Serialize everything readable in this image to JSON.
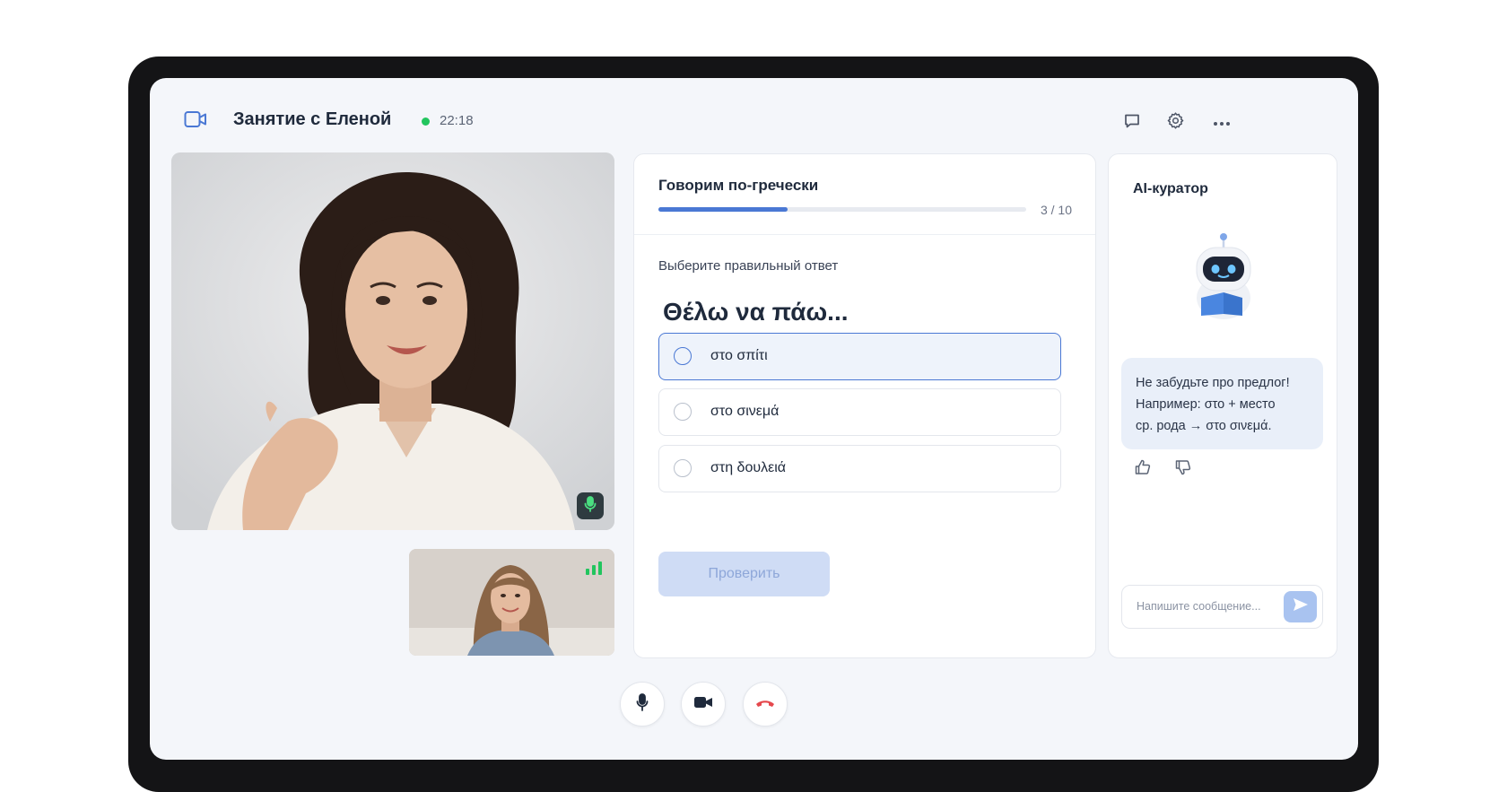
{
  "header": {
    "title": "Занятие с Еленой",
    "timer": "22:18",
    "icons": [
      "video-camera-icon",
      "chat-icon",
      "gear-icon",
      "more-icon"
    ]
  },
  "quiz": {
    "title": "Говорим по-гречески",
    "progress_label": "3 / 10",
    "progress_value": 0.3,
    "instruction": "Выберите правильный ответ",
    "question": "Θέλω να πάω...",
    "options": [
      {
        "label": "στο σπίτι",
        "selected": true
      },
      {
        "label": "στο σινεμά",
        "selected": false
      },
      {
        "label": "στη δουλειά",
        "selected": false
      }
    ],
    "check_label": "Проверить"
  },
  "ai": {
    "title": "AI-куратор",
    "message_lines": [
      "Не забудьте про предлог!",
      "Например: στο + место",
      "ср. рода → στο σινεμά."
    ],
    "input_placeholder": "Напишите сообщение..."
  },
  "colors": {
    "accent": "#4a78d4",
    "live": "#22c55e",
    "hangup": "#e5484d",
    "button_disabled": "#cfdcf5"
  }
}
